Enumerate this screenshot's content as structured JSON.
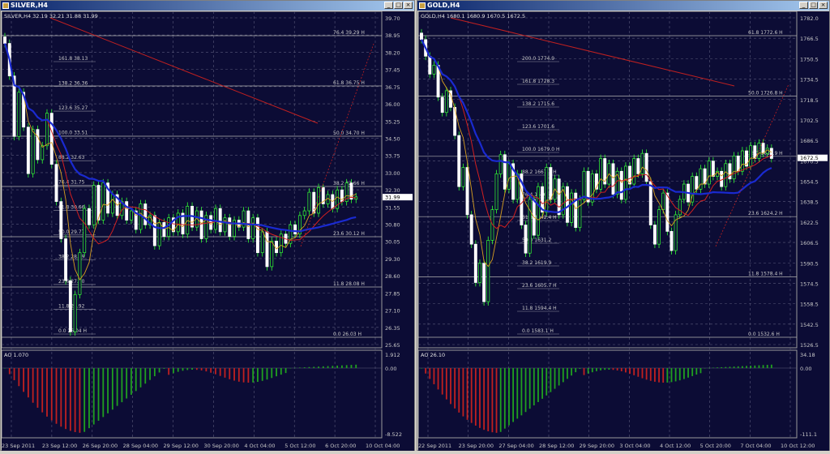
{
  "windows": [
    {
      "title": "SILVER,H4",
      "info": "SILVER,H4  32.19 32.21 31.88 31.99",
      "ao_label": "AO 1.070",
      "price_ticks": [
        "39.70",
        "38.95",
        "38.20",
        "37.45",
        "36.75",
        "36.00",
        "35.25",
        "34.50",
        "33.75",
        "33.00",
        "32.30",
        "31.55",
        "30.80",
        "30.05",
        "29.30",
        "28.60",
        "27.85",
        "27.10",
        "26.35",
        "25.65"
      ],
      "ao_ticks": [
        "1.912",
        "0.00",
        "-8.522"
      ],
      "current_price": "31.99",
      "time_ticks": [
        "23 Sep 2011",
        "23 Sep 12:00",
        "26 Sep 20:00",
        "28 Sep 04:00",
        "29 Sep 12:00",
        "30 Sep 20:00",
        "4 Oct 04:00",
        "5 Oct 12:00",
        "6 Oct 20:00",
        "10 Oct 04:00"
      ],
      "fib_right": [
        "76.4  39.29 H",
        "61.8  36.75 H",
        "50.0  34.70 H",
        "38.2  32.66 H",
        "23.6  30.12 H",
        "11.8  28.08 H",
        "0.0  26.03 H"
      ],
      "fib_left": [
        "161.8  38.13",
        "138.2  36.36",
        "123.6  35.27",
        "100.0  33.51",
        "88.2  32.63",
        "76.4  31.75",
        "61.8  30.66",
        "50.0  29.77",
        "38.2  28.89",
        "23.6  27.80",
        "11.8  26.92",
        "0.0  26.04 H"
      ],
      "closes": [
        38.6,
        37.2,
        34.6,
        36.5,
        35.0,
        33.0,
        34.9,
        33.6,
        34.2,
        35.6,
        33.4,
        31.8,
        30.2,
        28.4,
        26.2,
        27.8,
        29.6,
        31.5,
        30.8,
        32.5,
        31.0,
        32.6,
        31.3,
        32.1,
        31.2,
        31.8,
        31.0,
        31.4,
        30.6,
        31.7,
        30.8,
        31.2,
        29.9,
        30.9,
        30.3,
        31.1,
        30.5,
        31.3,
        30.4,
        31.6,
        30.7,
        31.4,
        30.2,
        31.2,
        30.6,
        31.5,
        30.5,
        31.1,
        30.3,
        31.0,
        30.7,
        31.4,
        30.2,
        31.1,
        29.6,
        30.5,
        29.0,
        30.1,
        29.6,
        30.4,
        30.0,
        30.8,
        30.4,
        31.2,
        31.4,
        32.2,
        31.3,
        32.4,
        31.7,
        32.1,
        31.5,
        32.3,
        31.8,
        32.6,
        31.9,
        32.0
      ]
    },
    {
      "title": "GOLD,H4",
      "info": "GOLD,H4  1680.1 1680.9 1670.5 1672.5",
      "ao_label": "AO 26.10",
      "price_ticks": [
        "1782.0",
        "1766.5",
        "1750.5",
        "1734.5",
        "1718.5",
        "1702.5",
        "1686.5",
        "1670.5",
        "1654.5",
        "1638.5",
        "1622.5",
        "1606.5",
        "1590.5",
        "1574.5",
        "1558.5",
        "1542.5",
        "1526.5"
      ],
      "ao_ticks": [
        "34.18",
        "0.00",
        "-111.1"
      ],
      "current_price": "1672.5",
      "time_ticks": [
        "22 Sep 2011",
        "23 Sep 20:00",
        "27 Sep 04:00",
        "28 Sep 12:00",
        "29 Sep 20:00",
        "3 Oct 04:00",
        "4 Oct 12:00",
        "5 Oct 20:00",
        "7 Oct 04:00",
        "10 Oct 12:00"
      ],
      "fib_right": [
        "61.8  1772.6 H",
        "50.0  1726.8 H",
        "38.2  1680.9 H",
        "23.6  1624.2 H",
        "11.8  1578.4 H",
        "0.0  1532.6 H"
      ],
      "fib_left": [
        "200.0  1774.9",
        "161.8  1728.3",
        "138.2  1715.6",
        "123.6  1701.6",
        "100.0  1679.0 H",
        "88.2  1667.7 H",
        "76.4  1656.4 H",
        "61.8  1642.4 H",
        "50.0  1631.2",
        "38.2  1619.9",
        "23.6  1605.7 H",
        "11.8  1594.4 H",
        "0.0  1583.1 H"
      ],
      "closes": [
        1765,
        1752,
        1738,
        1745,
        1720,
        1708,
        1725,
        1712,
        1690,
        1650,
        1665,
        1628,
        1605,
        1575,
        1590,
        1560,
        1608,
        1632,
        1660,
        1675,
        1648,
        1668,
        1640,
        1660,
        1620,
        1598,
        1640,
        1612,
        1650,
        1630,
        1665,
        1640,
        1656,
        1628,
        1650,
        1622,
        1645,
        1618,
        1640,
        1662,
        1638,
        1660,
        1648,
        1672,
        1652,
        1668,
        1644,
        1662,
        1640,
        1666,
        1652,
        1672,
        1660,
        1676,
        1654,
        1620,
        1605,
        1632,
        1645,
        1615,
        1600,
        1628,
        1640,
        1652,
        1638,
        1658,
        1648,
        1664,
        1652,
        1670,
        1658,
        1662,
        1650,
        1668,
        1656,
        1674,
        1662,
        1678,
        1666,
        1682,
        1672,
        1684,
        1676,
        1680,
        1672
      ]
    }
  ]
}
